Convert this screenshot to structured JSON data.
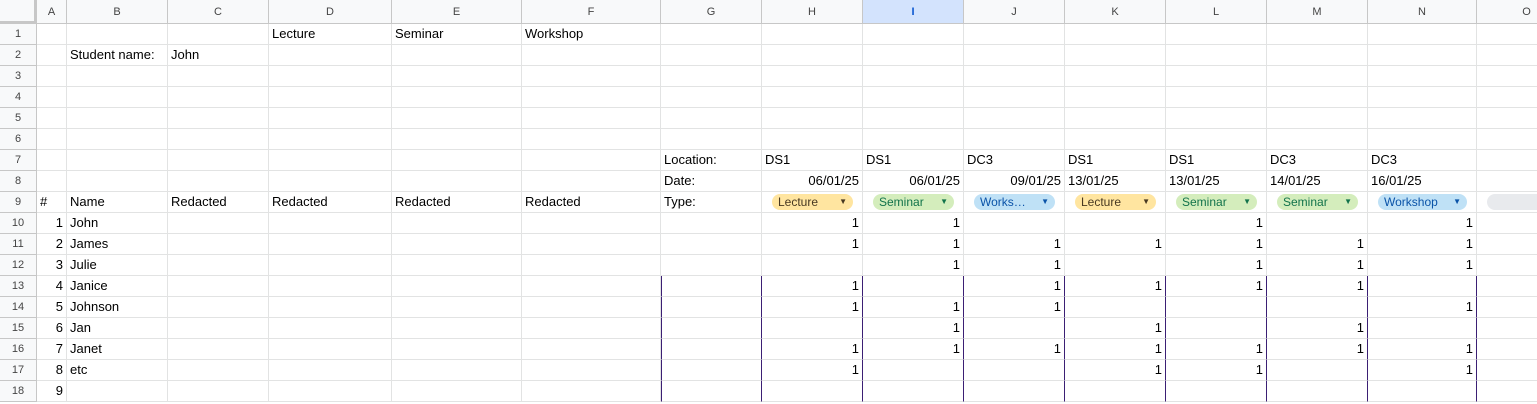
{
  "columns": [
    "A",
    "B",
    "C",
    "D",
    "E",
    "F",
    "G",
    "H",
    "I",
    "J",
    "K",
    "L",
    "M",
    "N",
    "O"
  ],
  "selected_column": "I",
  "rows": [
    "1",
    "2",
    "3",
    "4",
    "5",
    "6",
    "7",
    "8",
    "9",
    "10",
    "11",
    "12",
    "13",
    "14",
    "15",
    "16",
    "17",
    "18"
  ],
  "header_rows": {
    "row1": {
      "D": "Lecture",
      "E": "Seminar",
      "F": "Workshop"
    },
    "row2": {
      "B": "Student name:",
      "C": "John"
    },
    "row7": {
      "G": "Location:",
      "H": "DS1",
      "I": "DS1",
      "J": "DC3",
      "K": "DS1",
      "L": "DS1",
      "M": "DC3",
      "N": "DC3"
    },
    "row8": {
      "G": "Date:",
      "H": "06/01/25",
      "I": "06/01/25",
      "J": "09/01/25",
      "K": "13/01/25",
      "L": "13/01/25",
      "M": "14/01/25",
      "N": "16/01/25"
    },
    "row9": {
      "A": "#",
      "B": "Name",
      "C": "Redacted",
      "D": "Redacted",
      "E": "Redacted",
      "F": "Redacted",
      "G": "Type:"
    }
  },
  "type_chips": [
    {
      "col": "H",
      "label": "Lecture",
      "bg": "#ffe5a0",
      "color": "#473821"
    },
    {
      "col": "I",
      "label": "Seminar",
      "bg": "#d4edbc",
      "color": "#11734b"
    },
    {
      "col": "J",
      "label": "Works…",
      "bg": "#bfe1f6",
      "color": "#0a53a8"
    },
    {
      "col": "K",
      "label": "Lecture",
      "bg": "#ffe5a0",
      "color": "#473821"
    },
    {
      "col": "L",
      "label": "Seminar",
      "bg": "#d4edbc",
      "color": "#11734b"
    },
    {
      "col": "M",
      "label": "Seminar",
      "bg": "#d4edbc",
      "color": "#11734b"
    },
    {
      "col": "N",
      "label": "Workshop",
      "bg": "#bfe1f6",
      "color": "#0a53a8"
    },
    {
      "col": "O",
      "label": "",
      "bg": "#e8eaed",
      "color": "#444"
    }
  ],
  "students": [
    {
      "num": "1",
      "name": "John",
      "marks": {
        "H": "1",
        "I": "1",
        "L": "1",
        "N": "1"
      }
    },
    {
      "num": "2",
      "name": "James",
      "marks": {
        "H": "1",
        "I": "1",
        "J": "1",
        "K": "1",
        "L": "1",
        "M": "1",
        "N": "1"
      }
    },
    {
      "num": "3",
      "name": "Julie",
      "marks": {
        "I": "1",
        "J": "1",
        "L": "1",
        "M": "1",
        "N": "1"
      }
    },
    {
      "num": "4",
      "name": "Janice",
      "marks": {
        "H": "1",
        "J": "1",
        "K": "1",
        "L": "1",
        "M": "1"
      }
    },
    {
      "num": "5",
      "name": "Johnson",
      "marks": {
        "H": "1",
        "I": "1",
        "J": "1",
        "N": "1"
      }
    },
    {
      "num": "6",
      "name": "Jan",
      "marks": {
        "I": "1",
        "K": "1",
        "M": "1"
      }
    },
    {
      "num": "7",
      "name": "Janet",
      "marks": {
        "H": "1",
        "I": "1",
        "J": "1",
        "K": "1",
        "L": "1",
        "M": "1",
        "N": "1"
      }
    },
    {
      "num": "8",
      "name": "etc",
      "marks": {
        "H": "1",
        "K": "1",
        "L": "1",
        "N": "1"
      }
    },
    {
      "num": "9",
      "name": "",
      "marks": {}
    }
  ],
  "colors": {
    "grid": "#e2e3e3",
    "header_bg": "#f8f9fa",
    "selected_header": "#d3e3fd",
    "border_dark": "#3b1f74"
  }
}
